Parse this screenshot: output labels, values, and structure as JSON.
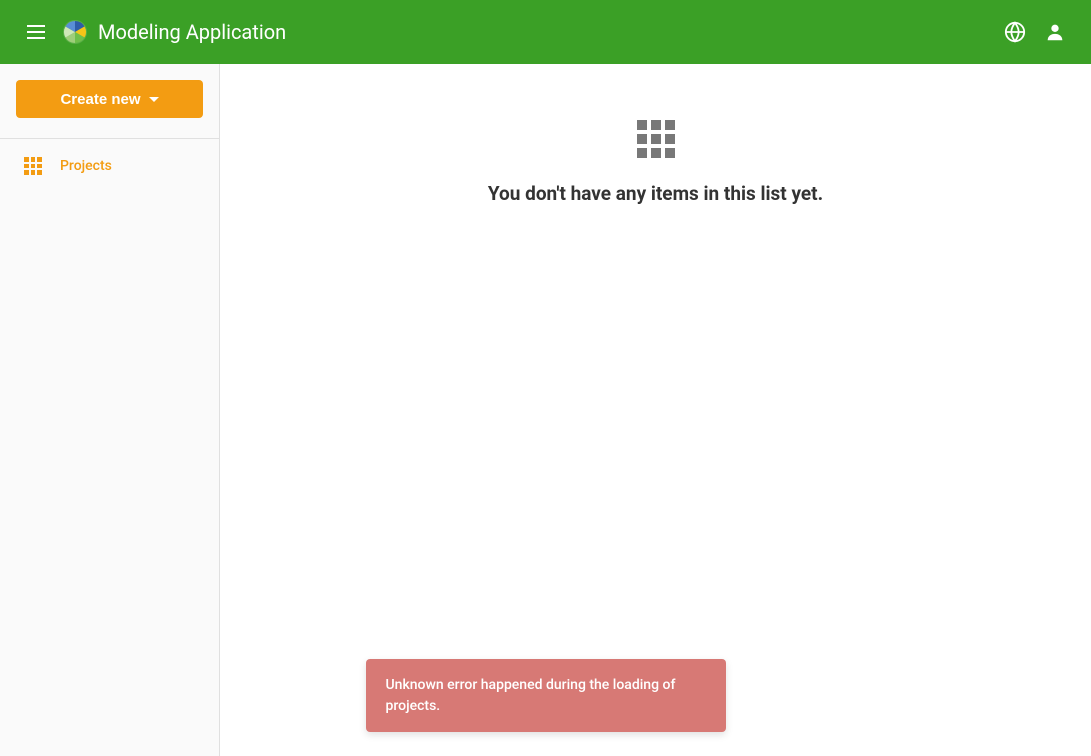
{
  "header": {
    "title": "Modeling Application"
  },
  "sidebar": {
    "create_label": "Create new",
    "items": [
      {
        "label": "Projects"
      }
    ]
  },
  "main": {
    "empty_message": "You don't have any items in this list yet."
  },
  "toast": {
    "message": "Unknown error happened during the loading of projects."
  },
  "colors": {
    "primary": "#3ba026",
    "accent": "#f39c12",
    "error": "#d77975"
  }
}
